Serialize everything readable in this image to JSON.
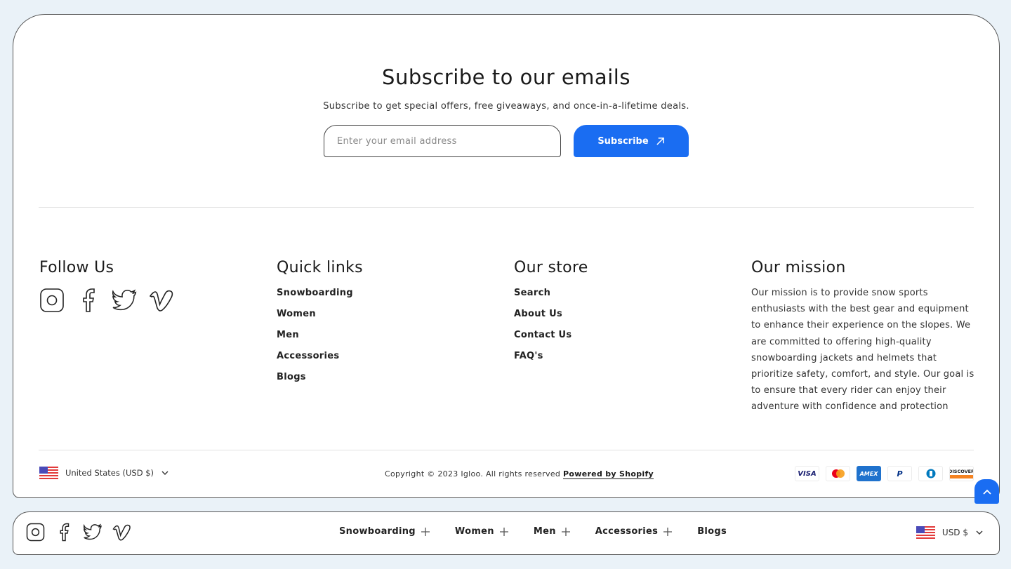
{
  "subscribe": {
    "title": "Subscribe to our emails",
    "description": "Subscribe to get special offers, free giveaways, and once-in-a-lifetime deals.",
    "email_placeholder": "Enter your email address",
    "email_value": "",
    "button_label": "Subscribe",
    "button_icon": "arrow-up-right-icon"
  },
  "follow": {
    "heading": "Follow Us",
    "icons": [
      "instagram-icon",
      "facebook-icon",
      "twitter-icon",
      "vimeo-icon"
    ]
  },
  "quick_links": {
    "heading": "Quick links",
    "items": [
      "Snowboarding",
      "Women",
      "Men",
      "Accessories",
      "Blogs"
    ]
  },
  "our_store": {
    "heading": "Our store",
    "items": [
      "Search",
      "About Us",
      "Contact Us",
      "FAQ's"
    ]
  },
  "mission": {
    "heading": "Our mission",
    "text": "Our mission is to provide snow sports enthusiasts with the best gear and equipment to enhance their experience on the slopes. We are committed to offering high-quality snowboarding jackets and helmets that prioritize safety, comfort, and style. Our goal is to ensure that every rider can enjoy their adventure with confidence and protection"
  },
  "footer_bottom": {
    "country_selector": "United States (USD $)",
    "copyright": "Copyright © 2023 Igloo. All rights reserved",
    "powered_by": "Powered by Shopify",
    "payment_methods": [
      "VISA",
      "Mastercard",
      "AMEX",
      "PayPal",
      "Diners Club",
      "DISCOVER"
    ]
  },
  "navbar": {
    "items": [
      {
        "label": "Snowboarding",
        "expandable": true
      },
      {
        "label": "Women",
        "expandable": true
      },
      {
        "label": "Men",
        "expandable": true
      },
      {
        "label": "Accessories",
        "expandable": true
      },
      {
        "label": "Blogs",
        "expandable": false
      }
    ],
    "currency": "USD $"
  },
  "colors": {
    "accent": "#1a6df2",
    "background": "#eaf2f8",
    "text": "#1b1b1b"
  }
}
